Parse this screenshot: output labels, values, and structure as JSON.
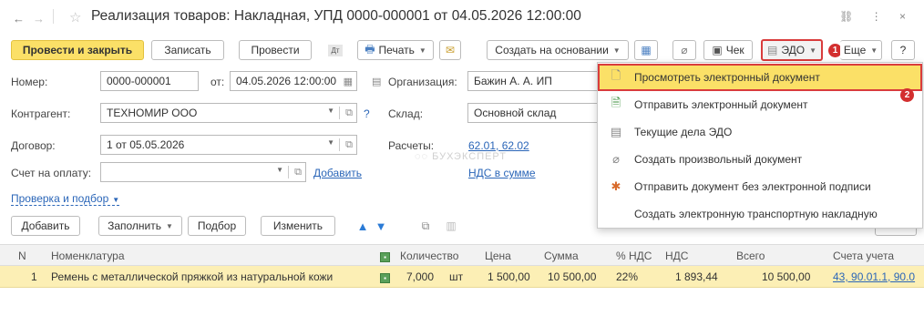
{
  "window": {
    "title": "Реализация товаров: Накладная, УПД 0000-000001 от 04.05.2026 12:00:00",
    "back": "←",
    "forward": "→",
    "icons": "⛓ ⋮ ×"
  },
  "toolbar": {
    "post_close": "Провести и закрыть",
    "save": "Записать",
    "post": "Провести",
    "print": "Печать",
    "create_based": "Создать на основании",
    "check": "Чек",
    "edo": "ЭДО",
    "more": "Еще",
    "help": "?"
  },
  "form": {
    "number_label": "Номер:",
    "number_value": "0000-000001",
    "date_label": "от:",
    "date_value": "04.05.2026 12:00:00",
    "org_label": "Организация:",
    "org_value": "Бажин А. А. ИП",
    "contractor_label": "Контрагент:",
    "contractor_value": "ТЕХНОМИР ООО",
    "warehouse_label": "Склад:",
    "warehouse_value": "Основной склад",
    "contract_label": "Договор:",
    "contract_value": "1 от 05.05.2026",
    "calc_label": "Расчеты:",
    "calc_value": "62.01, 62.02",
    "invoice_label": "Счет на оплату:",
    "add_link": "Добавить",
    "vat_link": "НДС в сумме",
    "check_link": "Проверка и подбор",
    "watermark": "БУХЭКСПЕРТ"
  },
  "tabletoolbar": {
    "add": "Добавить",
    "fill": "Заполнить",
    "select": "Подбор",
    "change": "Изменить"
  },
  "menu": {
    "items": [
      "Просмотреть электронный документ",
      "Отправить электронный документ",
      "Текущие дела ЭДО",
      "Создать произвольный документ",
      "Отправить документ без электронной подписи",
      "Создать электронную транспортную накладную"
    ],
    "badge1": "1",
    "badge2": "2"
  },
  "grid": {
    "headers": [
      "N",
      "Номенклатура",
      "Количество",
      "Цена",
      "Сумма",
      "% НДС",
      "НДС",
      "Всего",
      "Счета учета"
    ],
    "rows": [
      {
        "n": "1",
        "name": "Ремень с металлической пряжкой из натуральной кожи",
        "qty": "7,000",
        "unit": "шт",
        "price": "1 500,00",
        "sum": "10 500,00",
        "vat_rate": "22%",
        "vat": "1 893,44",
        "total": "10 500,00",
        "accounts": "43, 90.01.1, 90.0"
      }
    ]
  },
  "colors": {
    "accent_yellow": "#fbe067",
    "highlight_red": "#d93c3c",
    "link_blue": "#2b66b8",
    "row_yellow": "#fcefb5"
  }
}
